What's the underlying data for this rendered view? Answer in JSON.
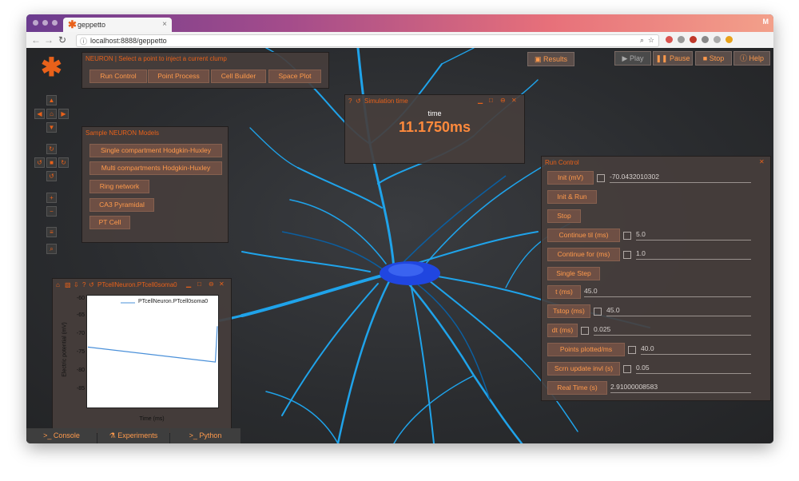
{
  "browser": {
    "tab_title": "geppetto",
    "url": "localhost:8888/geppetto",
    "profile_initial": "M"
  },
  "app": {
    "logo": "✱",
    "top_buttons": {
      "results": "Results",
      "play": "Play",
      "pause": "Pause",
      "stop": "Stop",
      "help": "Help"
    }
  },
  "neuron_panel": {
    "title": "NEURON | Select a point to inject a current clump",
    "buttons": [
      "Run Control",
      "Point Process",
      "Cell Builder",
      "Space Plot"
    ]
  },
  "sample_models": {
    "title": "Sample NEURON Models",
    "buttons": [
      "Single compartment Hodgkin-Huxley",
      "Multi compartments Hodgkin-Huxley",
      "Ring network",
      "CA3 Pyramidal",
      "PT Cell"
    ]
  },
  "sim_time": {
    "title": "Simulation time",
    "label": "time",
    "value": "11.1750ms"
  },
  "plot": {
    "title": "PTcellNeuron.PTcell0soma0",
    "legend": "PTcellNeuron.PTcell0soma0",
    "ylabel": "Electric potential (mV)",
    "xlabel": "Time (ms)",
    "yticks": [
      "-60",
      "-65",
      "-70",
      "-75",
      "-80",
      "-85"
    ]
  },
  "chart_data": {
    "type": "line",
    "title": "PTcellNeuron.PTcell0soma0",
    "xlabel": "Time (ms)",
    "ylabel": "Electric potential (mV)",
    "ylim": [
      -87,
      -57
    ],
    "x": [
      0,
      11.0,
      11.175
    ],
    "series": [
      {
        "name": "PTcellNeuron.PTcell0soma0",
        "values": [
          -70.8,
          -74.8,
          -65.2
        ]
      }
    ],
    "xlim": [
      0,
      11.175
    ],
    "colors": {
      "line": "#4a90d9"
    }
  },
  "run_control": {
    "title": "Run Control",
    "rows": [
      {
        "label": "Init (mV)",
        "value": "-70.0432010302",
        "checkbox": true
      },
      {
        "label": "Init & Run",
        "value": null,
        "checkbox": false
      },
      {
        "label": "Stop",
        "value": null,
        "checkbox": false
      },
      {
        "label": "Continue til (ms)",
        "value": "5.0",
        "checkbox": true
      },
      {
        "label": "Continue for (ms)",
        "value": "1.0",
        "checkbox": true
      },
      {
        "label": "Single Step",
        "value": null,
        "checkbox": false
      },
      {
        "label": "t (ms)",
        "value": "45.0",
        "checkbox": false
      },
      {
        "label": "Tstop (ms)",
        "value": "45.0",
        "checkbox": true
      },
      {
        "label": "dt (ms)",
        "value": "0.025",
        "checkbox": true
      },
      {
        "label": "Points plotted/ms",
        "value": "40.0",
        "checkbox": true
      },
      {
        "label": "Scrn update invl (s)",
        "value": "0.05",
        "checkbox": true
      },
      {
        "label": "Real Time (s)",
        "value": "2.91000008583",
        "checkbox": false
      }
    ]
  },
  "bottom_tabs": [
    "Console",
    "Experiments",
    "Python"
  ],
  "colors": {
    "accent": "#e8611a",
    "neuron": "#1fa3ea",
    "soma": "#2046e0"
  }
}
